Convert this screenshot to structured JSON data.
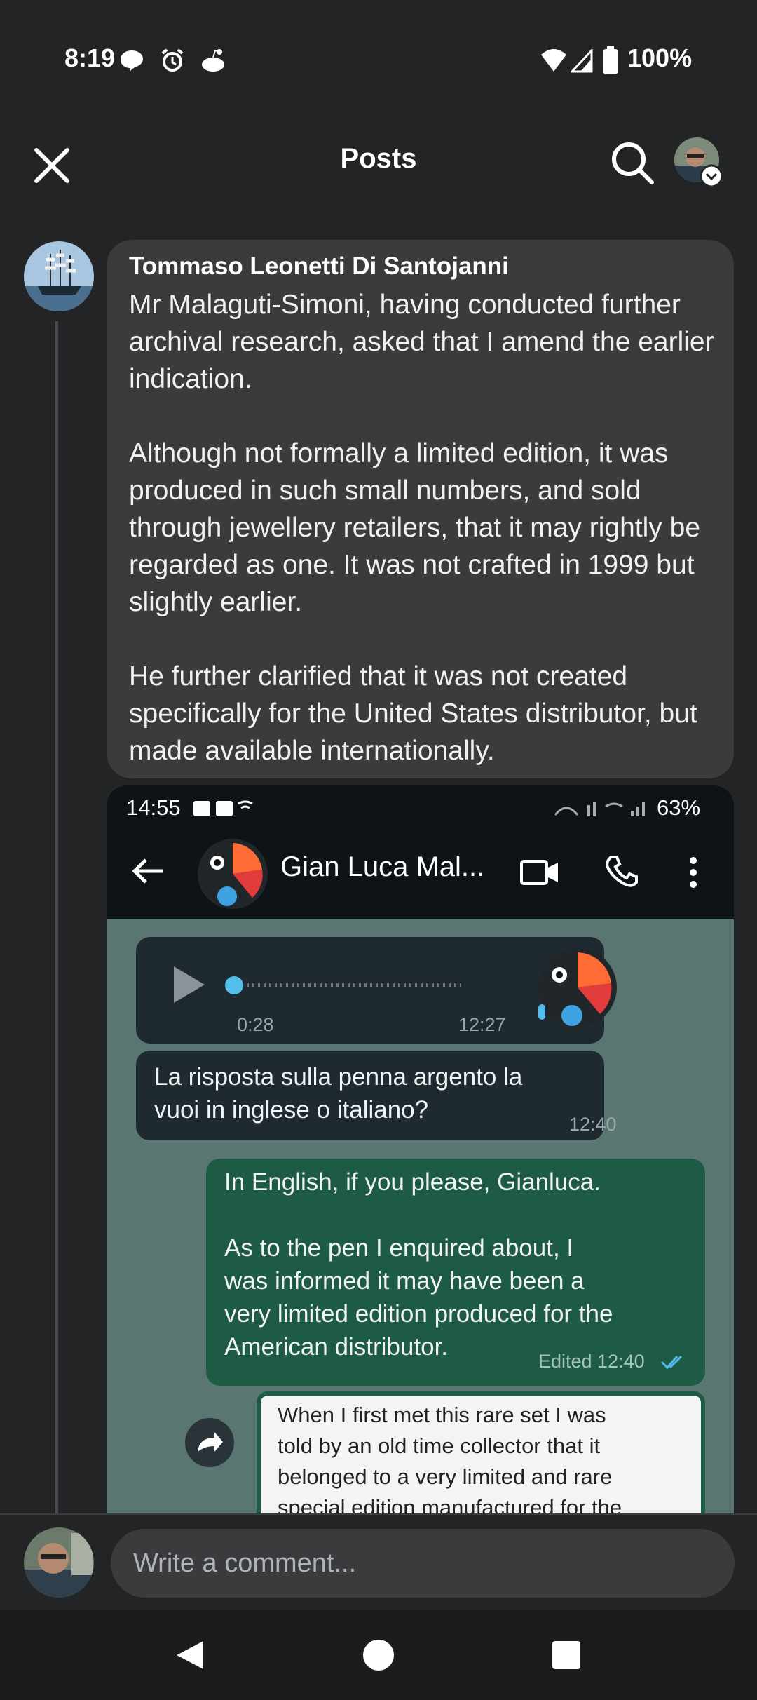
{
  "status": {
    "time": "8:19",
    "battery": "100%"
  },
  "header": {
    "title": "Posts"
  },
  "comment": {
    "author": "Tommaso Leonetti Di Santojanni",
    "text": "Mr Malaguti-Simoni, having conducted further archival research, asked that I amend the earlier indication.\n\nAlthough not formally a limited edition, it was produced in such small numbers, and sold through jewellery retailers, that it may rightly be regarded as one. It was not crafted in 1999 but slightly earlier.\n\nHe further clarified that it was not created specifically for the United States distributor, but made available internationally."
  },
  "screenshot": {
    "status_time": "14:55",
    "battery": "63%",
    "contact_name": "Gian Luca Mal...",
    "voice_duration": "0:28",
    "voice_time": "12:27",
    "msg1_text": "La risposta sulla penna argento la\nvuoi in inglese o italiano?",
    "msg1_time": "12:40",
    "msg2_text": "In English, if you please, Gianluca.\n\nAs to the pen I enquired about, I\nwas informed it may have been a\nvery limited edition produced for the\nAmerican distributor.",
    "msg2_time": "Edited 12:40",
    "quote_text": "When I first met this rare set I was\ntold by an old time collector that it\nbelonged to a very limited and rare\nspecial edition manufactured for the"
  },
  "comment_input": {
    "placeholder": "Write a comment..."
  },
  "colors": {
    "background": "#232426",
    "bubble": "#3a3b3d",
    "outgoing": "#1d5b45",
    "accent": "#53bdeb"
  }
}
